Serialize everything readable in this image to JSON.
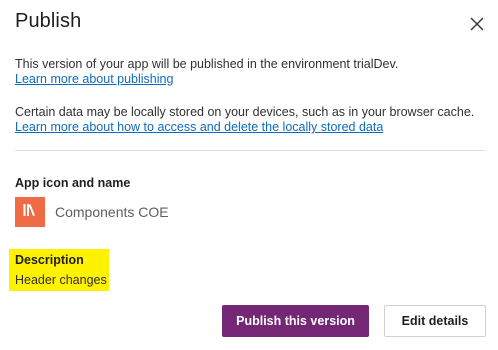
{
  "dialog": {
    "title": "Publish",
    "close_icon": "close-icon"
  },
  "info": {
    "environment_text": "This version of your app will be published in the environment trialDev.",
    "learn_publishing_link": "Learn more about publishing",
    "storage_text": "Certain data may be locally stored on your devices, such as in your browser cache.",
    "learn_storage_link": "Learn more about how to access and delete the locally stored data"
  },
  "app": {
    "section_label": "App icon and name",
    "icon": "books-icon",
    "icon_color": "#f06b45",
    "name": "Components COE"
  },
  "description": {
    "section_label": "Description",
    "value": "Header changes",
    "highlight_color": "#fff200"
  },
  "buttons": {
    "publish_label": "Publish this version",
    "publish_color": "#742774",
    "edit_label": "Edit details"
  }
}
